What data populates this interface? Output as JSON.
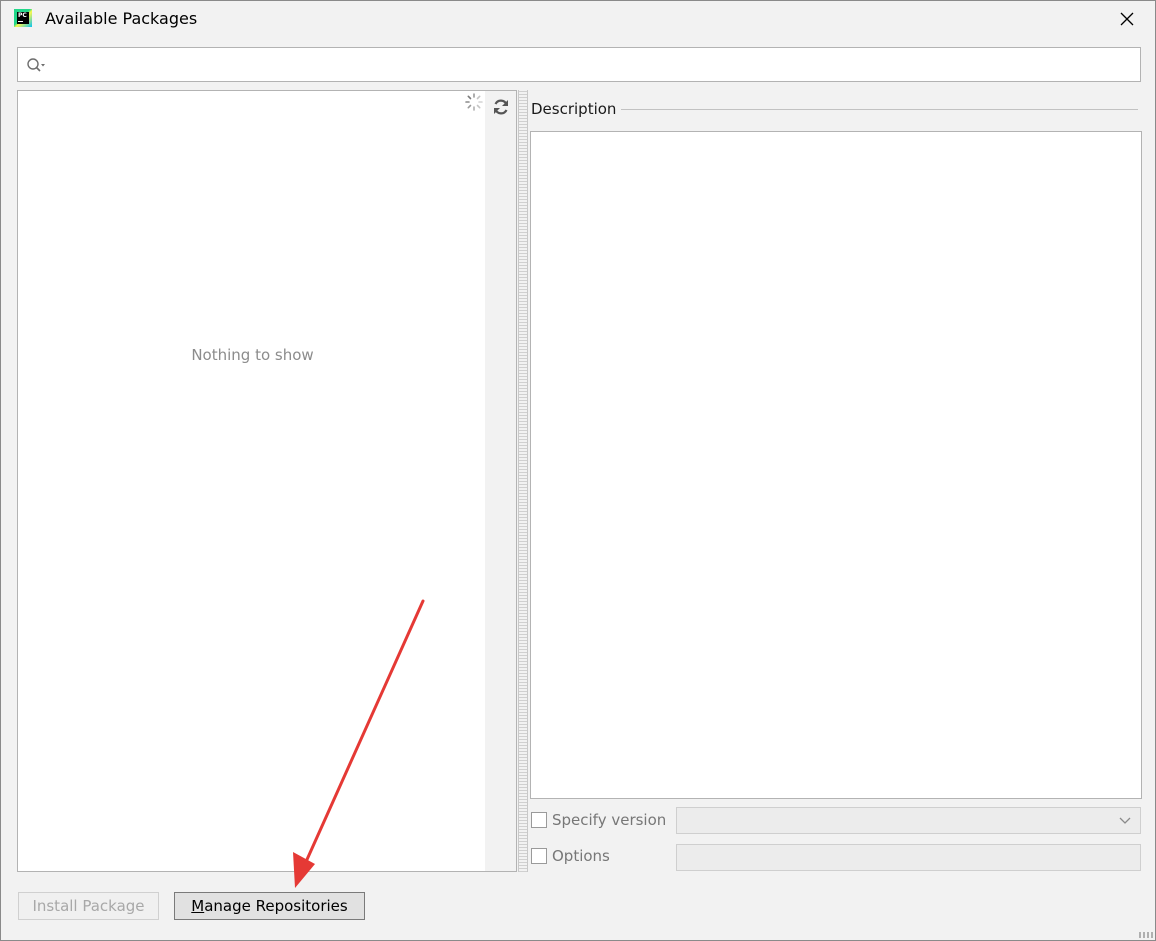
{
  "window": {
    "title": "Available Packages",
    "app_icon": "pycharm-icon",
    "close_icon": "close-icon"
  },
  "search": {
    "value": "",
    "placeholder": "",
    "icon": "search-icon"
  },
  "package_list": {
    "empty_text": "Nothing to show",
    "loading_icon": "spinner-icon",
    "refresh_icon": "refresh-icon"
  },
  "description": {
    "label": "Description",
    "content": ""
  },
  "options": {
    "specify_version_label": "Specify version",
    "specify_version_checked": false,
    "version_value": "",
    "options_label": "Options",
    "options_checked": false,
    "options_value": ""
  },
  "buttons": {
    "install": "Install Package",
    "manage_mnemonic": "M",
    "manage_rest": "anage Repositories"
  },
  "colors": {
    "window_bg": "#f2f2f2",
    "panel_bg": "#ffffff",
    "annotation_arrow": "#e53935"
  }
}
